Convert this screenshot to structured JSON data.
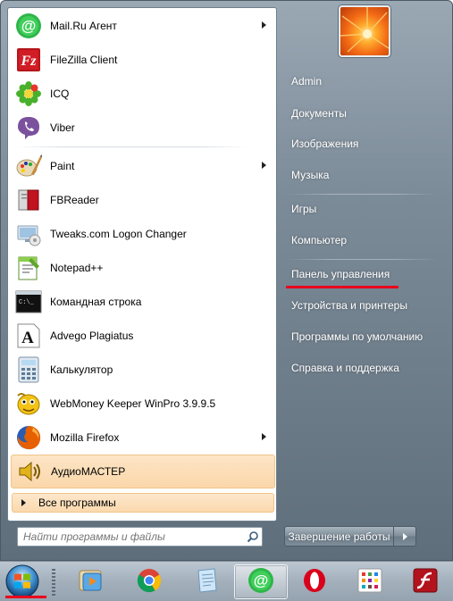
{
  "programs": [
    {
      "label": "Mail.Ru Агент",
      "icon": "mailru-agent-icon",
      "has_submenu": true
    },
    {
      "label": "FileZilla Client",
      "icon": "filezilla-icon",
      "has_submenu": false
    },
    {
      "label": "ICQ",
      "icon": "icq-icon",
      "has_submenu": false
    },
    {
      "label": "Viber",
      "icon": "viber-icon",
      "has_submenu": false
    },
    {
      "label": "Paint",
      "icon": "paint-icon",
      "has_submenu": true
    },
    {
      "label": "FBReader",
      "icon": "fbreader-icon",
      "has_submenu": false
    },
    {
      "label": "Tweaks.com Logon Changer",
      "icon": "logon-changer-icon",
      "has_submenu": false
    },
    {
      "label": "Notepad++",
      "icon": "notepadpp-icon",
      "has_submenu": false
    },
    {
      "label": "Командная строка",
      "icon": "cmd-icon",
      "has_submenu": false
    },
    {
      "label": "Advego Plagiatus",
      "icon": "advego-icon",
      "has_submenu": false
    },
    {
      "label": "Калькулятор",
      "icon": "calculator-icon",
      "has_submenu": false
    },
    {
      "label": "WebMoney Keeper WinPro 3.9.9.5",
      "icon": "webmoney-icon",
      "has_submenu": false
    },
    {
      "label": "Mozilla Firefox",
      "icon": "firefox-icon",
      "has_submenu": true
    },
    {
      "label": "АудиоМАСТЕР",
      "icon": "audiomaster-icon",
      "has_submenu": false,
      "highlighted": true
    }
  ],
  "all_programs_label": "Все программы",
  "search_placeholder": "Найти программы и файлы",
  "right_menu": {
    "admin": "Admin",
    "documents": "Документы",
    "images": "Изображения",
    "music": "Музыка",
    "games": "Игры",
    "computer": "Компьютер",
    "control_panel": "Панель управления",
    "devices_printers": "Устройства и принтеры",
    "default_programs": "Программы по умолчанию",
    "help_support": "Справка и поддержка"
  },
  "shutdown_label": "Завершение работы",
  "taskbar_items": [
    "start-orb",
    "media-player-icon",
    "chrome-icon",
    "notepad-icon",
    "mailru-agent-icon",
    "opera-icon",
    "app-grid-icon",
    "flash-icon"
  ],
  "colors": {
    "highlight": "#fbd7aa",
    "annotation_red": "#e8001c",
    "menu_glass": "#7c8b98"
  }
}
